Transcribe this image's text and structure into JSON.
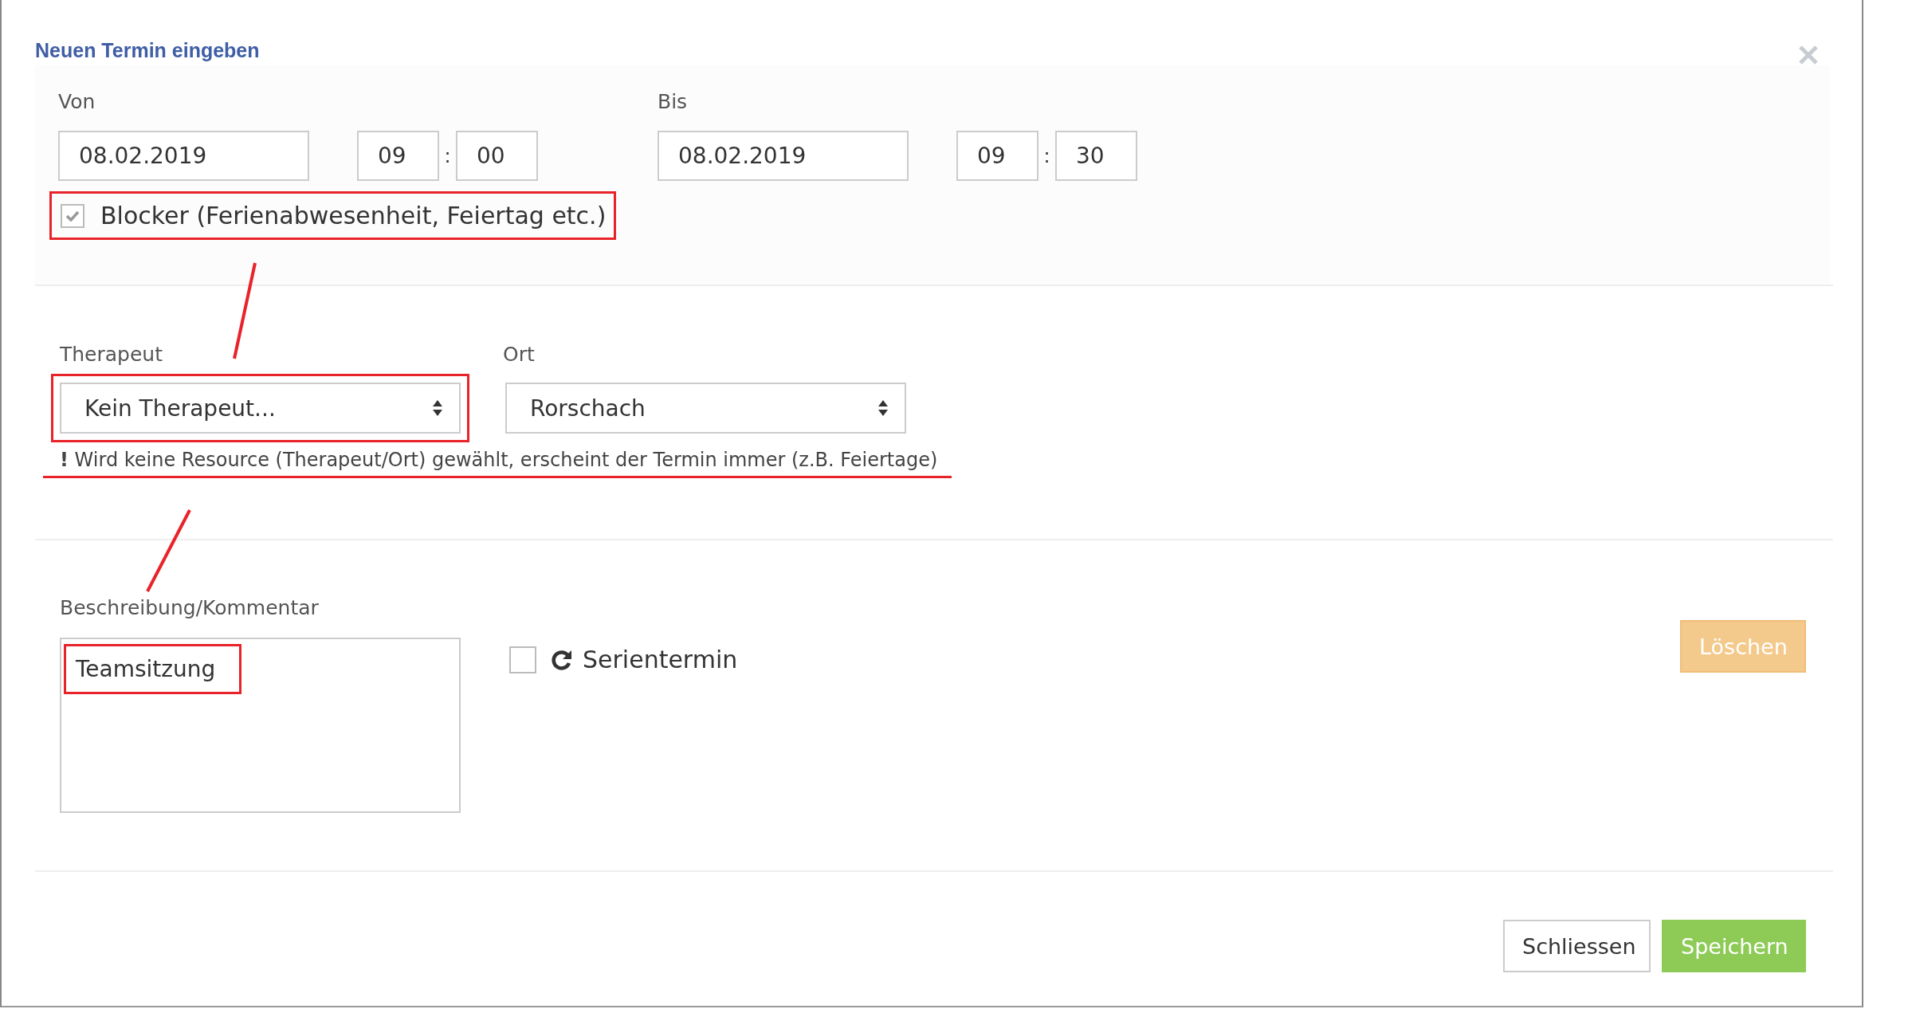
{
  "dialog": {
    "title": "Neuen Termin eingeben"
  },
  "von": {
    "label": "Von",
    "date": "08.02.2019",
    "hour": "09",
    "separator": ":",
    "minute": "00"
  },
  "bis": {
    "label": "Bis",
    "date": "08.02.2019",
    "hour": "09",
    "separator": ":",
    "minute": "30"
  },
  "blocker": {
    "label": "Blocker (Ferienabwesenheit, Feiertag etc.)",
    "checked": true,
    "highlighted": true
  },
  "therapeut": {
    "label": "Therapeut",
    "value": "Kein Therapeut...",
    "highlighted": true
  },
  "ort": {
    "label": "Ort",
    "value": "Rorschach",
    "highlighted": false
  },
  "warning": {
    "text": "**!** Wird keine Resource (Therapeut/Ort) gewählt, erscheint der Termin immer (z.B. Feiertage)",
    "highlighted": true
  },
  "comment": {
    "label": "Beschreibung/Kommentar",
    "value": "Teamsitzung",
    "highlighted": true
  },
  "series": {
    "label": "Serientermin",
    "checked": false
  },
  "buttons": [
    {
      "kind": "delete",
      "label": "Löschen"
    },
    {
      "kind": "close",
      "label": "Schliessen"
    },
    {
      "kind": "save",
      "label": "Speichern"
    }
  ]
}
